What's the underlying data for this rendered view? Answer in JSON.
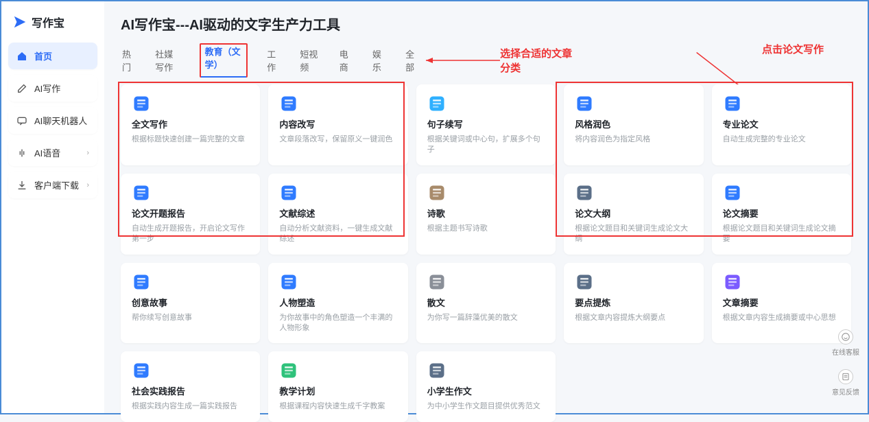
{
  "brand": {
    "name": "写作宝"
  },
  "sidebar": {
    "items": [
      {
        "label": "首页",
        "icon": "home"
      },
      {
        "label": "AI写作",
        "icon": "edit"
      },
      {
        "label": "AI聊天机器人",
        "icon": "chat"
      },
      {
        "label": "AI语音",
        "icon": "voice"
      },
      {
        "label": "客户端下载",
        "icon": "download"
      }
    ]
  },
  "page": {
    "title": "AI写作宝---AI驱动的文字生产力工具"
  },
  "tabs": {
    "items": [
      "热门",
      "社媒写作",
      "教育（文学）",
      "工作",
      "短视频",
      "电商",
      "娱乐",
      "全部"
    ],
    "active_index": 2
  },
  "annotations": {
    "left": "选择合适的文章分类",
    "right": "点击论文写作"
  },
  "cards": [
    {
      "title": "全文写作",
      "desc": "根据标题快速创建一篇完整的文章",
      "color": "#2f7bff"
    },
    {
      "title": "内容改写",
      "desc": "文章段落改写，保留原义一键润色",
      "color": "#2f7bff"
    },
    {
      "title": "句子续写",
      "desc": "根据关键词或中心句，扩展多个句子",
      "color": "#2fb0ff"
    },
    {
      "title": "风格润色",
      "desc": "将内容润色为指定风格",
      "color": "#2f7bff"
    },
    {
      "title": "专业论文",
      "desc": "自动生成完整的专业论文",
      "color": "#2f7bff"
    },
    {
      "title": "论文开题报告",
      "desc": "自动生成开题报告，开启论文写作第一步",
      "color": "#2f7bff"
    },
    {
      "title": "文献综述",
      "desc": "自动分析文献资料，一键生成文献综述",
      "color": "#2f7bff"
    },
    {
      "title": "诗歌",
      "desc": "根据主题书写诗歌",
      "color": "#a88b6b"
    },
    {
      "title": "论文大纲",
      "desc": "根据论文题目和关键词生成论文大纲",
      "color": "#5b6f88"
    },
    {
      "title": "论文摘要",
      "desc": "根据论文题目和关键词生成论文摘要",
      "color": "#2f7bff"
    },
    {
      "title": "创意故事",
      "desc": "帮你续写创意故事",
      "color": "#2f7bff"
    },
    {
      "title": "人物塑造",
      "desc": "为你故事中的角色塑造一个丰满的人物形象",
      "color": "#2f7bff"
    },
    {
      "title": "散文",
      "desc": "为你写一篇辞藻优美的散文",
      "color": "#8a8f98"
    },
    {
      "title": "要点提炼",
      "desc": "根据文章内容提炼大纲要点",
      "color": "#5b6f88"
    },
    {
      "title": "文章摘要",
      "desc": "根据文章内容生成摘要或中心思想",
      "color": "#7b5bff"
    },
    {
      "title": "社会实践报告",
      "desc": "根据实践内容生成一篇实践报告",
      "color": "#2f7bff"
    },
    {
      "title": "教学计划",
      "desc": "根据课程内容快速生成千字教案",
      "color": "#2fc27b"
    },
    {
      "title": "小学生作文",
      "desc": "为中小学生作文题目提供优秀范文",
      "color": "#5b6f88"
    }
  ],
  "float": {
    "support_label": "在线客服",
    "feedback_label": "意见反馈"
  }
}
